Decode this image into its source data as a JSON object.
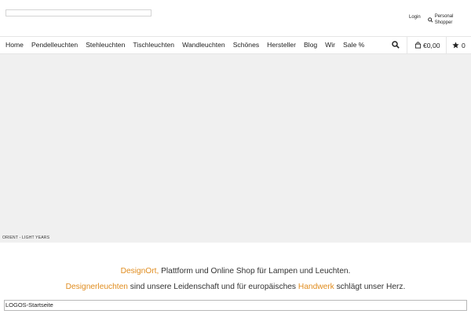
{
  "topbar": {
    "login_label": "Login",
    "personal_shopper_label": "Personal Shopper",
    "personal_shopper_icon": "search-icon"
  },
  "nav": {
    "items": [
      {
        "label": "Home"
      },
      {
        "label": "Pendelleuchten"
      },
      {
        "label": "Stehleuchten"
      },
      {
        "label": "Tischleuchten"
      },
      {
        "label": "Wandleuchten"
      },
      {
        "label": "Schönes"
      },
      {
        "label": "Hersteller"
      },
      {
        "label": "Blog"
      },
      {
        "label": "Wir"
      },
      {
        "label": "Sale %"
      }
    ],
    "search_icon": "search-icon",
    "cart_icon": "shopping-bag-icon",
    "cart_total": "€0,00",
    "wishlist_icon": "star-icon",
    "wishlist_count": "0"
  },
  "hero": {
    "caption": "ORIENT - LIGHT YEARS",
    "background_color": "#f0f0f0"
  },
  "intro": {
    "line1_brand": "DesignOrt,",
    "line1_rest": " Plattform und Online Shop für Lampen und Leuchten.",
    "line2_link1": "Designerleuchten",
    "line2_mid": " sind unsere Leidenschaft und für europäisches ",
    "line2_link2": "Handwerk",
    "line2_end": " schlägt unser Herz.",
    "accent_color": "#e08c1e"
  },
  "footer_image": {
    "alt_text": "LOGOS-Startseite"
  }
}
